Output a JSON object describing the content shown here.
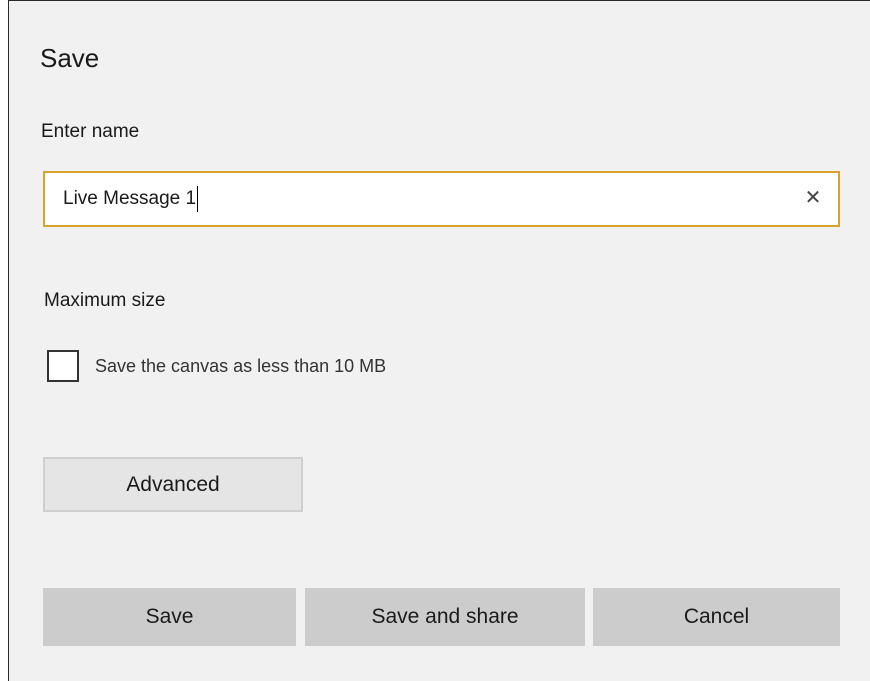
{
  "dialog": {
    "title": "Save",
    "name_label": "Enter name",
    "name_value": "Live Message 1",
    "clear_glyph": "✕",
    "size_label": "Maximum size",
    "checkbox_label": "Save the canvas as less than 10 MB",
    "checkbox_checked": false,
    "advanced_label": "Advanced"
  },
  "footer": {
    "save_label": "Save",
    "save_share_label": "Save and share",
    "cancel_label": "Cancel"
  },
  "colors": {
    "focus_border": "#d6a42b",
    "dialog_bg": "#f1f1f1",
    "footer_button_bg": "#cccccc"
  },
  "icons": {
    "clear": "close-icon"
  }
}
